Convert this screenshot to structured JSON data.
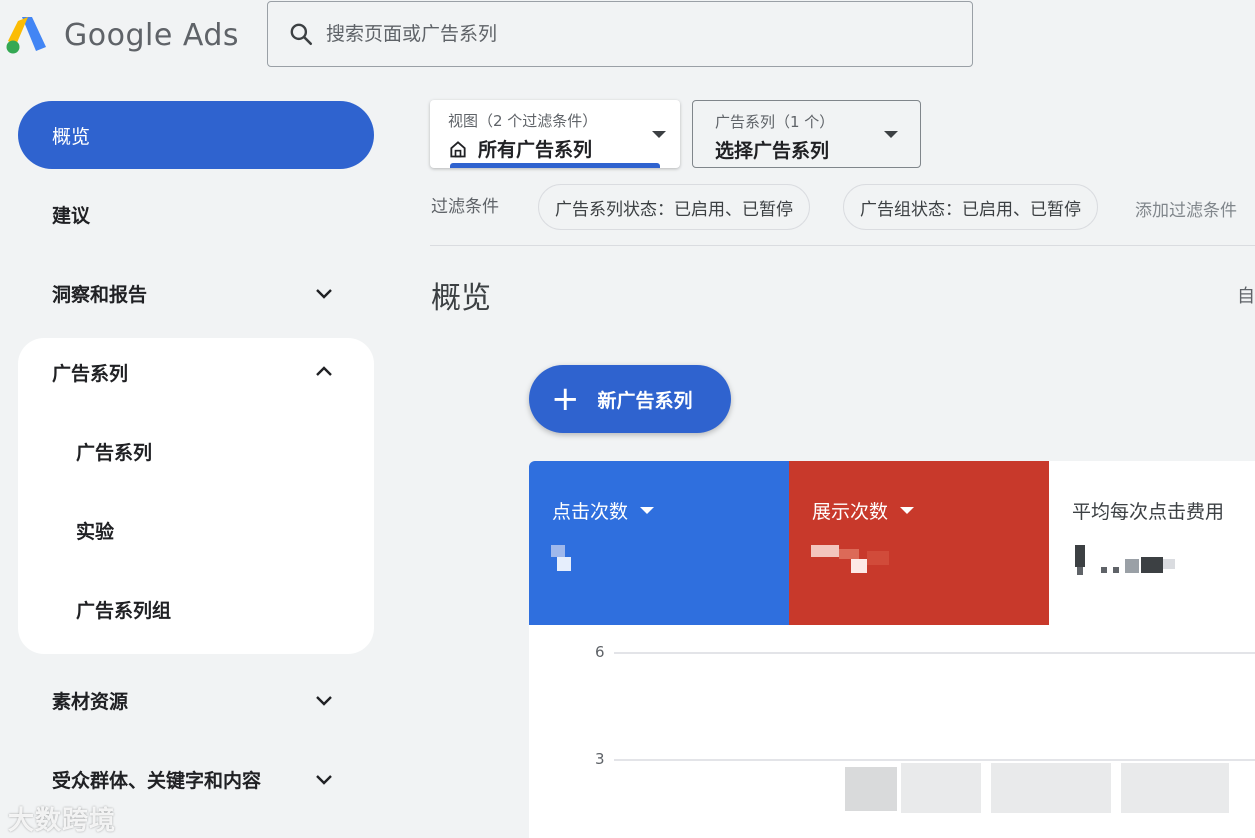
{
  "header": {
    "brand": "Google Ads",
    "search_placeholder": "搜索页面或广告系列",
    "colors": {
      "logo_blue": "#4285f4",
      "logo_yellow": "#fbbc04",
      "logo_green": "#34a853"
    }
  },
  "sidebar": {
    "items": [
      {
        "label": "概览",
        "active": true
      },
      {
        "label": "建议"
      },
      {
        "label": "洞察和报告",
        "expandable": true
      },
      {
        "label": "广告系列",
        "expanded": true,
        "children": [
          "广告系列",
          "实验",
          "广告系列组"
        ]
      },
      {
        "label": "素材资源",
        "expandable": true
      },
      {
        "label": "受众群体、关键字和内容",
        "expandable": true
      }
    ],
    "active_color": "#2f63cf"
  },
  "view_selector": {
    "label": "视图（2 个过滤条件）",
    "value": "所有广告系列",
    "icon": "home-icon"
  },
  "campaign_selector": {
    "label": "广告系列（1 个）",
    "value": "选择广告系列"
  },
  "filters": {
    "label": "过滤条件",
    "chips": [
      "广告系列状态：已启用、已暂停",
      "广告组状态：已启用、已暂停"
    ],
    "add": "添加过滤条件"
  },
  "main": {
    "title": "概览",
    "edge_char": "自",
    "new_campaign_button": "新广告系列"
  },
  "metrics": [
    {
      "label": "点击次数",
      "color": "#2f6fde",
      "has_dropdown": true
    },
    {
      "label": "展示次数",
      "color": "#c8392b",
      "has_dropdown": true
    },
    {
      "label": "平均每次点击费用",
      "color": "#ffffff",
      "has_dropdown": false
    }
  ],
  "chart": {
    "y_ticks": [
      "6",
      "3"
    ]
  },
  "watermark": "大数跨境"
}
